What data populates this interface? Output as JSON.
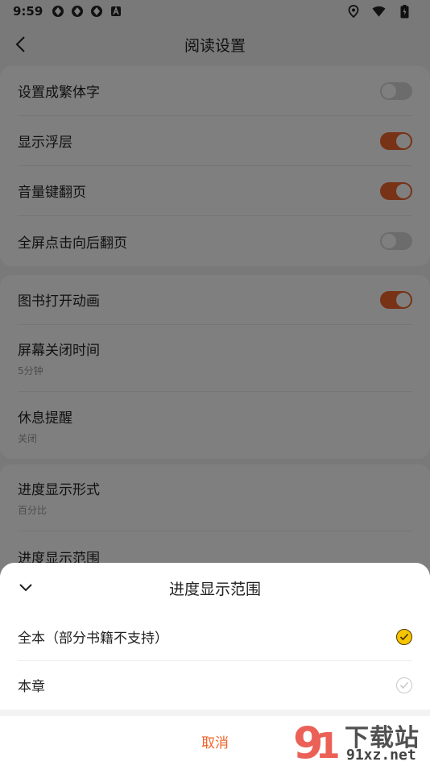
{
  "status_bar": {
    "time": "9:59"
  },
  "header": {
    "title": "阅读设置"
  },
  "settings": {
    "group1": [
      {
        "label": "设置成繁体字",
        "on": false
      },
      {
        "label": "显示浮层",
        "on": true
      },
      {
        "label": "音量键翻页",
        "on": true
      },
      {
        "label": "全屏点击向后翻页",
        "on": false
      }
    ],
    "group2": {
      "book_animation": {
        "label": "图书打开动画",
        "on": true
      },
      "screen_off": {
        "label": "屏幕关闭时间",
        "value": "5分钟"
      },
      "rest_reminder": {
        "label": "休息提醒",
        "value": "关闭"
      }
    },
    "group3": {
      "progress_format": {
        "label": "进度显示形式",
        "value": "百分比"
      },
      "progress_range": {
        "label": "进度显示范围"
      }
    }
  },
  "sheet": {
    "title": "进度显示范围",
    "options": [
      {
        "label": "全本（部分书籍不支持）",
        "selected": true
      },
      {
        "label": "本章",
        "selected": false
      }
    ],
    "cancel": "取消"
  },
  "watermark": {
    "text": "下载站",
    "domain": "91xz.net"
  },
  "colors": {
    "accent": "#f0642a",
    "check_selected": "#f6c400"
  }
}
